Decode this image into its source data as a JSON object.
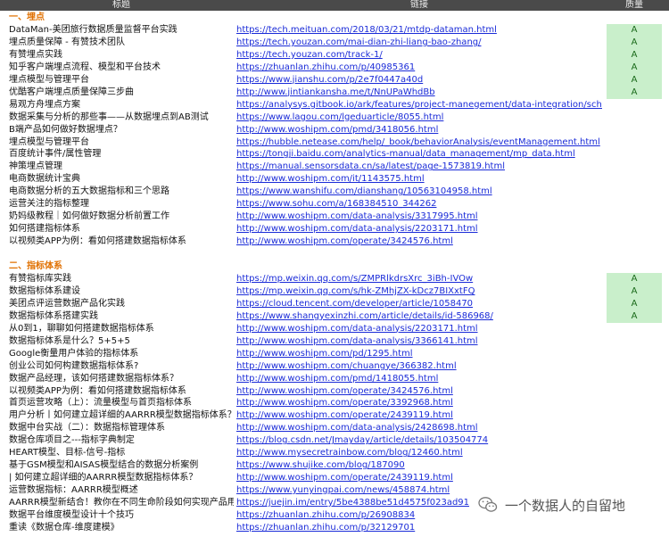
{
  "header": {
    "col_title": "标题",
    "col_link": "链接",
    "col_quality": "质量"
  },
  "sections": [
    {
      "title": "一、埋点",
      "rows": [
        {
          "title": "DataMan-美团旅行数据质量监督平台实践",
          "link": "https://tech.meituan.com/2018/03/21/mtdp-dataman.html",
          "quality": "A"
        },
        {
          "title": "埋点质量保障 - 有赞技术团队",
          "link": "https://tech.youzan.com/mai-dian-zhi-liang-bao-zhang/",
          "quality": "A"
        },
        {
          "title": "有赞埋点实践",
          "link": "https://tech.youzan.com/track-1/",
          "quality": "A"
        },
        {
          "title": "知乎客户端埋点流程、模型和平台技术",
          "link": "https://zhuanlan.zhihu.com/p/40985361",
          "quality": "A"
        },
        {
          "title": "埋点模型与管理平台",
          "link": "https://www.jianshu.com/p/2e7f0447a40d",
          "quality": "A"
        },
        {
          "title": "优酷客户端埋点质量保障三步曲",
          "link": "http://www.jintiankansha.me/t/NnUPaWhdBb",
          "quality": "A"
        },
        {
          "title": "易观方舟埋点方案",
          "link": "https://analysys.gitbook.io/ark/features/project-manegement/data-integration/schema",
          "quality": ""
        },
        {
          "title": "数据采集与分析的那些事——从数据埋点到AB测试",
          "link": "https://www.lagou.com/lgeduarticle/8055.html",
          "quality": ""
        },
        {
          "title": "B端产品如何做好数据埋点？",
          "link": "http://www.woshipm.com/pmd/3418056.html",
          "quality": ""
        },
        {
          "title": "埋点模型与管理平台",
          "link": "https://hubble.netease.com/help/_book/behaviorAnalysis/eventManagement.html",
          "quality": ""
        },
        {
          "title": "百度统计事件/属性管理",
          "link": "https://tongji.baidu.com/analytics-manual/data_management/mp_data.html",
          "quality": ""
        },
        {
          "title": "神策埋点管理",
          "link": "https://manual.sensorsdata.cn/sa/latest/page-1573819.html",
          "quality": ""
        },
        {
          "title": "电商数据统计宝典",
          "link": "http://www.woshipm.com/it/1143575.html",
          "quality": ""
        },
        {
          "title": "电商数据分析的五大数据指标和三个思路",
          "link": "https://www.wanshifu.com/dianshang/10563104958.html",
          "quality": ""
        },
        {
          "title": "运营关注的指标整理",
          "link": "https://www.sohu.com/a/168384510_344262",
          "quality": ""
        },
        {
          "title": "奶妈级教程｜如何做好数据分析前置工作",
          "link": "http://www.woshipm.com/data-analysis/3317995.html",
          "quality": ""
        },
        {
          "title": "如何搭建指标体系",
          "link": "http://www.woshipm.com/data-analysis/2203171.html",
          "quality": ""
        },
        {
          "title": "以视频类APP为例：看如何搭建数据指标体系",
          "link": "http://www.woshipm.com/operate/3424576.html",
          "quality": ""
        }
      ]
    },
    {
      "title": "二、指标体系",
      "rows": [
        {
          "title": "有赞指标库实践",
          "link": "https://mp.weixin.qq.com/s/ZMPRlkdrsXrc_3iBh-IVOw",
          "quality": "A"
        },
        {
          "title": "数据指标体系建设",
          "link": "https://mp.weixin.qq.com/s/hk-ZMhjZX-kDcz7BIXxtFQ",
          "quality": "A"
        },
        {
          "title": "美团点评运营数据产品化实践",
          "link": "https://cloud.tencent.com/developer/article/1058470",
          "quality": "A"
        },
        {
          "title": "数据指标体系搭建实践",
          "link": "https://www.shangyexinzhi.com/article/details/id-586968/",
          "quality": "A"
        },
        {
          "title": "从0到1，聊聊如何搭建数据指标体系",
          "link": "http://www.woshipm.com/data-analysis/2203171.html",
          "quality": ""
        },
        {
          "title": "数据指标体系是什么？5+5+5",
          "link": "http://www.woshipm.com/data-analysis/3366141.html",
          "quality": ""
        },
        {
          "title": "Google衡量用户体验的指标体系",
          "link": "http://www.woshipm.com/pd/1295.html",
          "quality": ""
        },
        {
          "title": "创业公司如何构建数据指标体系?",
          "link": "http://www.woshipm.com/chuangye/366382.html",
          "quality": ""
        },
        {
          "title": "数据产品经理，该如何搭建数据指标体系？",
          "link": "http://www.woshipm.com/pmd/1418055.html",
          "quality": ""
        },
        {
          "title": "以视频类APP为例：看如何搭建数据指标体系",
          "link": "http://www.woshipm.com/operate/3424576.html",
          "quality": ""
        },
        {
          "title": "首页运营攻略（上）：流量模型与首页指标体系",
          "link": "http://www.woshipm.com/operate/3392968.html",
          "quality": ""
        },
        {
          "title": "用户分析丨如何建立超详细的AARRR模型数据指标体系？",
          "link": "http://www.woshipm.com/operate/2439119.html",
          "quality": ""
        },
        {
          "title": "数据中台实战（二）：数据指标管理体系",
          "link": "http://www.woshipm.com/data-analysis/2428698.html",
          "quality": ""
        },
        {
          "title": "数据仓库项目之---指标字典制定",
          "link": "https://blog.csdn.net/Jmayday/article/details/103504774",
          "quality": ""
        },
        {
          "title": "HEART模型、目标-信号-指标",
          "link": "http://www.mysecretrainbow.com/blog/12460.html",
          "quality": ""
        },
        {
          "title": "基于GSM模型和AISAS模型结合的数据分析案例",
          "link": "https://www.shujike.com/blog/187090",
          "quality": ""
        },
        {
          "title": "| 如何建立超详细的AARRR模型数据指标体系？",
          "link": "http://www.woshipm.com/operate/2439119.html",
          "quality": ""
        },
        {
          "title": "运营数据指标：AARRR模型概述",
          "link": "https://www.yunyingpai.com/news/458874.html",
          "quality": ""
        },
        {
          "title": "AARRR模型新结合！教你在不同生命阶段如何实现产品用户增长",
          "link": "https://juejin.im/entry/5be4388be51d4575f023ad91",
          "quality": ""
        },
        {
          "title": "数据平台维度模型设计十个技巧",
          "link": "https://zhuanlan.zhihu.com/p/26908834",
          "quality": ""
        },
        {
          "title": "重读《数据仓库-维度建模》",
          "link": "https://zhuanlan.zhihu.com/p/32129701",
          "quality": ""
        }
      ]
    }
  ],
  "watermark": {
    "text": "一个数据人的自留地",
    "icon": "wechat-icon"
  },
  "colors": {
    "link": "#1a2bd8",
    "section": "#e07000",
    "quality_fill": "#c9efcb",
    "header_bg": "#4a4a4a"
  }
}
